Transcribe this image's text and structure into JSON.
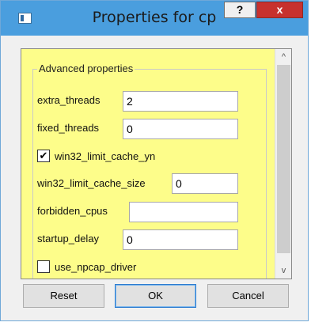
{
  "window": {
    "title": "Properties for cp",
    "help_label": "?",
    "close_label": "x"
  },
  "group": {
    "title": "Advanced properties"
  },
  "fields": {
    "extra_threads": {
      "label": "extra_threads",
      "value": "2"
    },
    "fixed_threads": {
      "label": "fixed_threads",
      "value": "0"
    },
    "win32_limit_cache_yn": {
      "label": "win32_limit_cache_yn",
      "checked": true,
      "check_glyph": "✔"
    },
    "win32_limit_cache_size": {
      "label": "win32_limit_cache_size",
      "value": "0"
    },
    "forbidden_cpus": {
      "label": "forbidden_cpus",
      "value": ""
    },
    "startup_delay": {
      "label": "startup_delay",
      "value": "0"
    },
    "use_npcap_driver": {
      "label": "use_npcap_driver",
      "checked": false
    }
  },
  "scrollbar": {
    "up_arrow": "^",
    "down_arrow": "v"
  },
  "buttons": {
    "reset": "Reset",
    "ok": "OK",
    "cancel": "Cancel"
  },
  "colors": {
    "titlebar": "#4a9ede",
    "panel_background": "#fdfd8a",
    "close_button": "#c7312e"
  }
}
